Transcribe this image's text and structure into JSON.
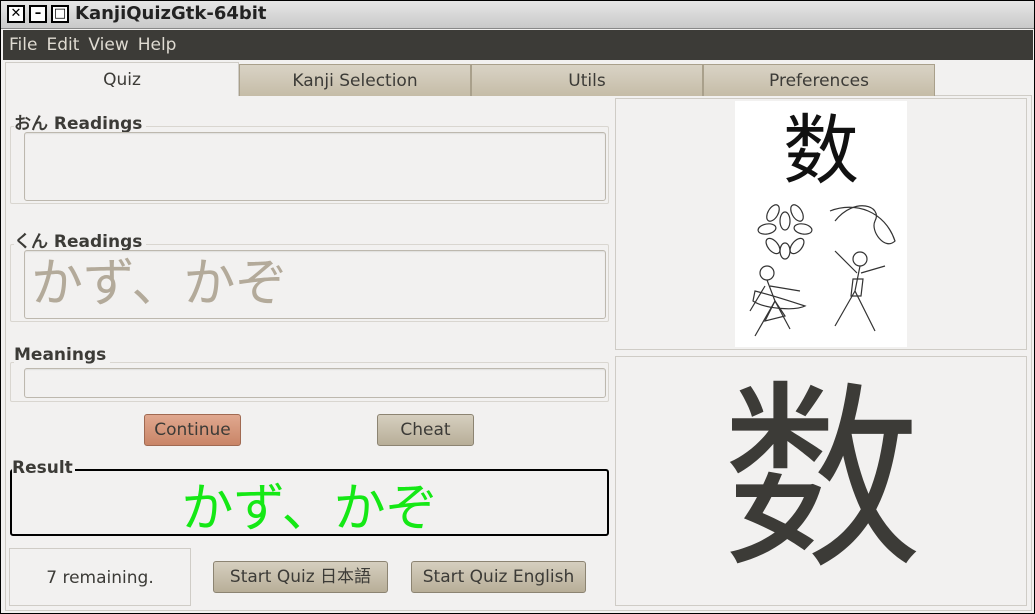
{
  "window": {
    "title": "KanjiQuizGtk-64bit"
  },
  "menubar": {
    "items": [
      "File",
      "Edit",
      "View",
      "Help"
    ]
  },
  "tabs": [
    {
      "label": "Quiz",
      "active": true
    },
    {
      "label": "Kanji Selection",
      "active": false
    },
    {
      "label": "Utils",
      "active": false
    },
    {
      "label": "Preferences",
      "active": false
    }
  ],
  "quiz": {
    "on_label": "おん Readings",
    "on_value": "",
    "kun_label": "くん Readings",
    "kun_value": "かず、かぞ",
    "meanings_label": "Meanings",
    "meanings_value": "",
    "continue_label": "Continue",
    "cheat_label": "Cheat",
    "result_label": "Result",
    "result_value": "かず、かぞ",
    "status": "7 remaining.",
    "start_jp_label": "Start Quiz 日本語",
    "start_en_label": "Start Quiz English"
  },
  "kanji": {
    "character": "数",
    "mnemonic_character": "数"
  },
  "colors": {
    "menubar_bg": "#3c3b37",
    "result_text": "#15e815",
    "continue_button": "#c98567"
  }
}
